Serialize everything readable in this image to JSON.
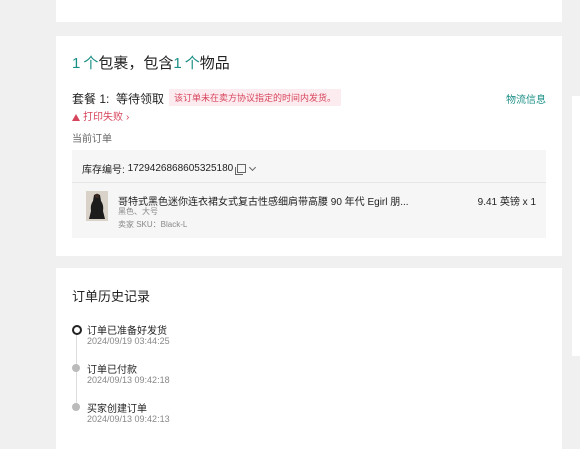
{
  "package": {
    "title_count_1": "1",
    "title_unit_1": "个",
    "title_text_1": "包裹，包含",
    "title_count_2": "1",
    "title_unit_2": "个",
    "title_text_2": "物品",
    "plan_label": "套餐 1:  等待领取",
    "warning": "该订单未在卖方协议指定的时间内发货。",
    "logistics_link": "物流信息",
    "print_fail": "打印失败",
    "current_order_label": "当前订单"
  },
  "order": {
    "sku_label": "库存编号: ",
    "sku_number": "1729426868605325180",
    "product": {
      "name": "哥特式黑色迷你连衣裙女式复古性感细肩带高腰 90 年代 Egirl 朋...",
      "variant": "黑色、大号",
      "seller_sku": "卖家 SKU：Black-L",
      "price": "9.41 英镑 x 1"
    }
  },
  "history": {
    "title": "订单历史记录",
    "items": [
      {
        "label": "订单已准备好发货",
        "time": "2024/09/19 03:44:25"
      },
      {
        "label": "订单已付款",
        "time": "2024/09/13 09:42:18"
      },
      {
        "label": "买家创建订单",
        "time": "2024/09/13 09:42:13"
      }
    ]
  }
}
